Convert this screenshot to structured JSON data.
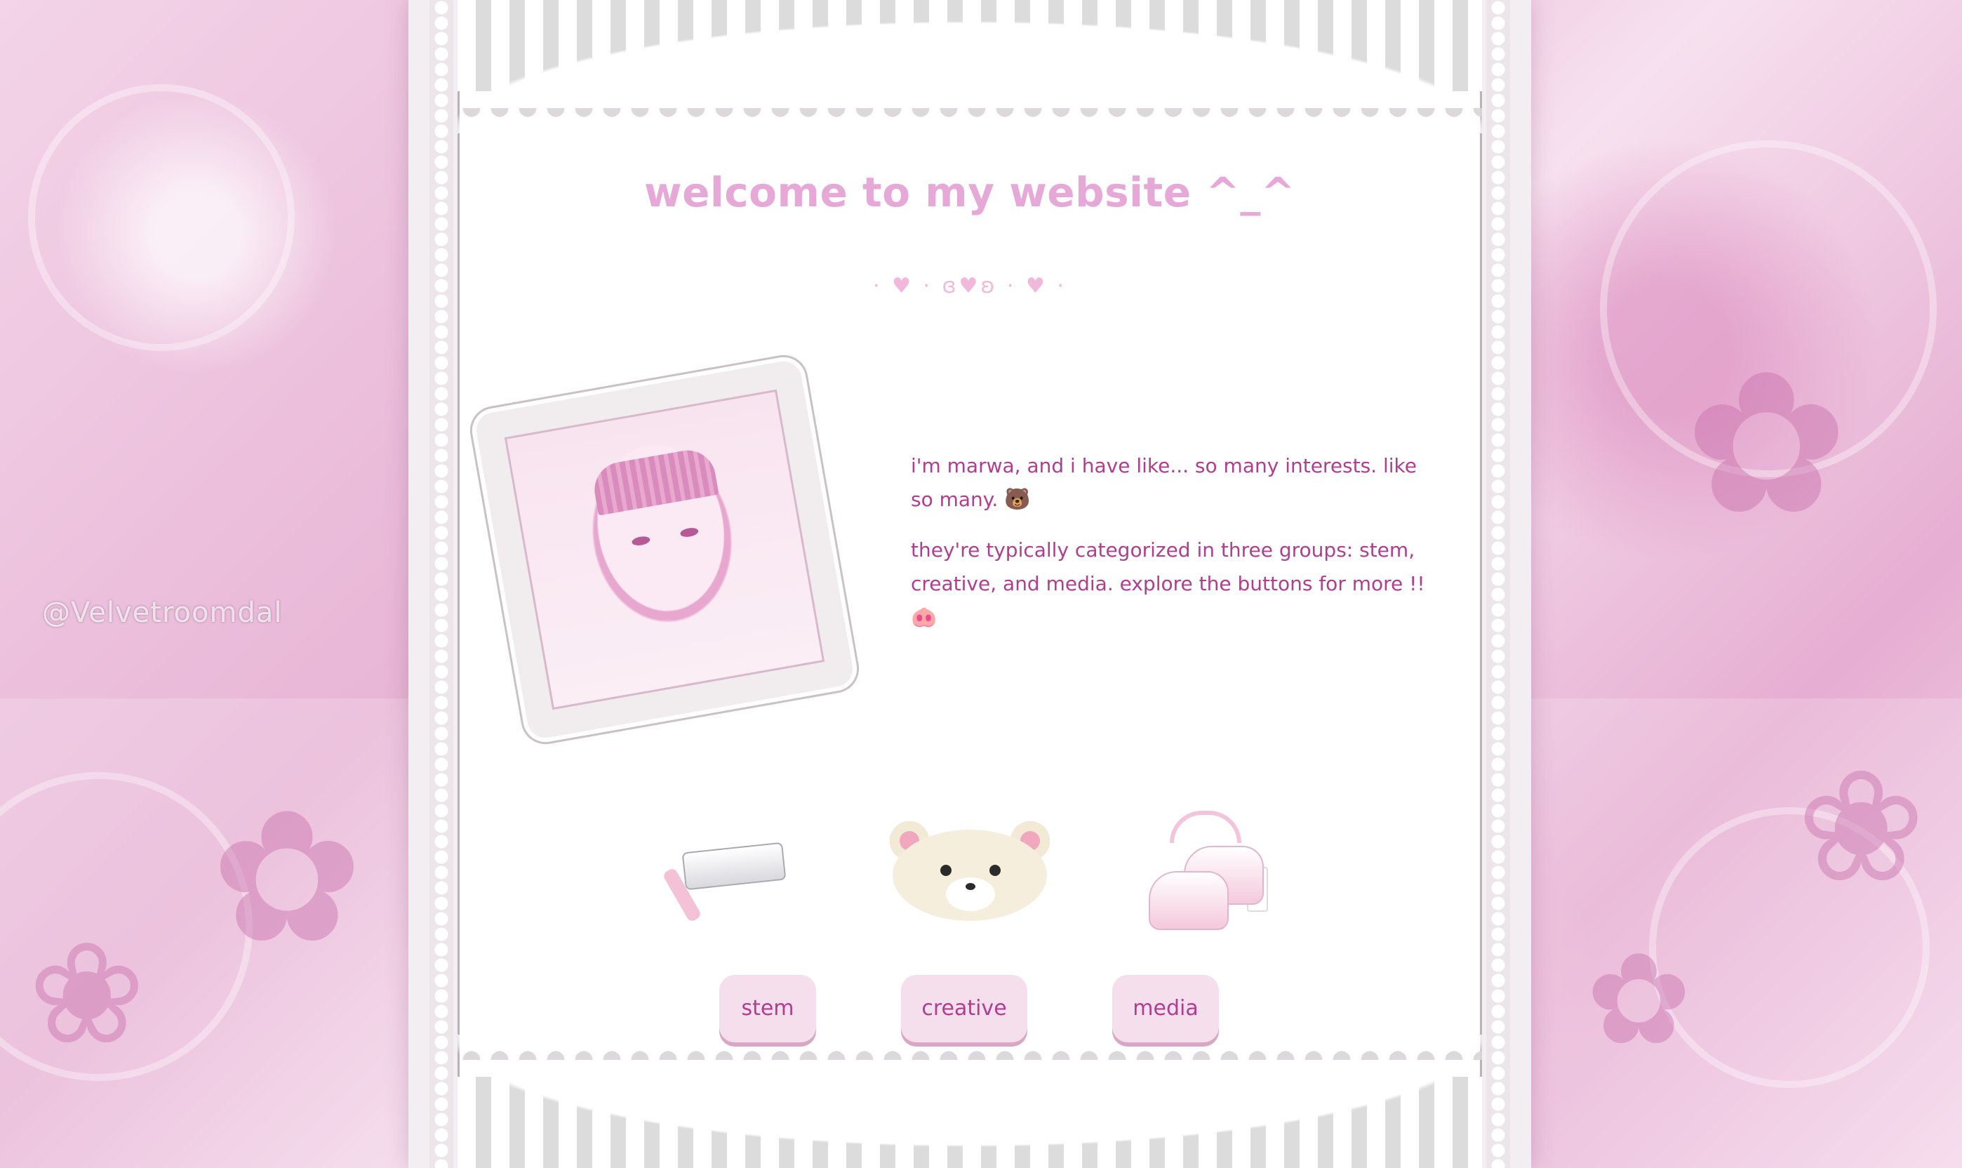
{
  "background": {
    "watermark": "@Velvetroomdal"
  },
  "header": {
    "title": "welcome to my website ^_^",
    "divider": "· ♥ · ɞ♥ʚ · ♥ ·"
  },
  "profile": {
    "photo_icon": "portrait-drawing"
  },
  "bio": {
    "paragraph_1": "i'm marwa, and i have like... so many interests. like so many.",
    "emoji_1": "🐻",
    "paragraph_2": "they're typically categorized in three groups: stem, creative, and media. explore the buttons for more !!",
    "emoji_2": "🐽"
  },
  "categories": [
    {
      "label": "stem",
      "icon": "usb-drive-icon"
    },
    {
      "label": "creative",
      "icon": "bear-plush-icon"
    },
    {
      "label": "media",
      "icon": "pink-shoes-icon"
    }
  ],
  "colors": {
    "title": "#e6a8d6",
    "text": "#b03e90",
    "button_bg": "#f6dfec",
    "button_shadow": "#d7a7c3"
  }
}
